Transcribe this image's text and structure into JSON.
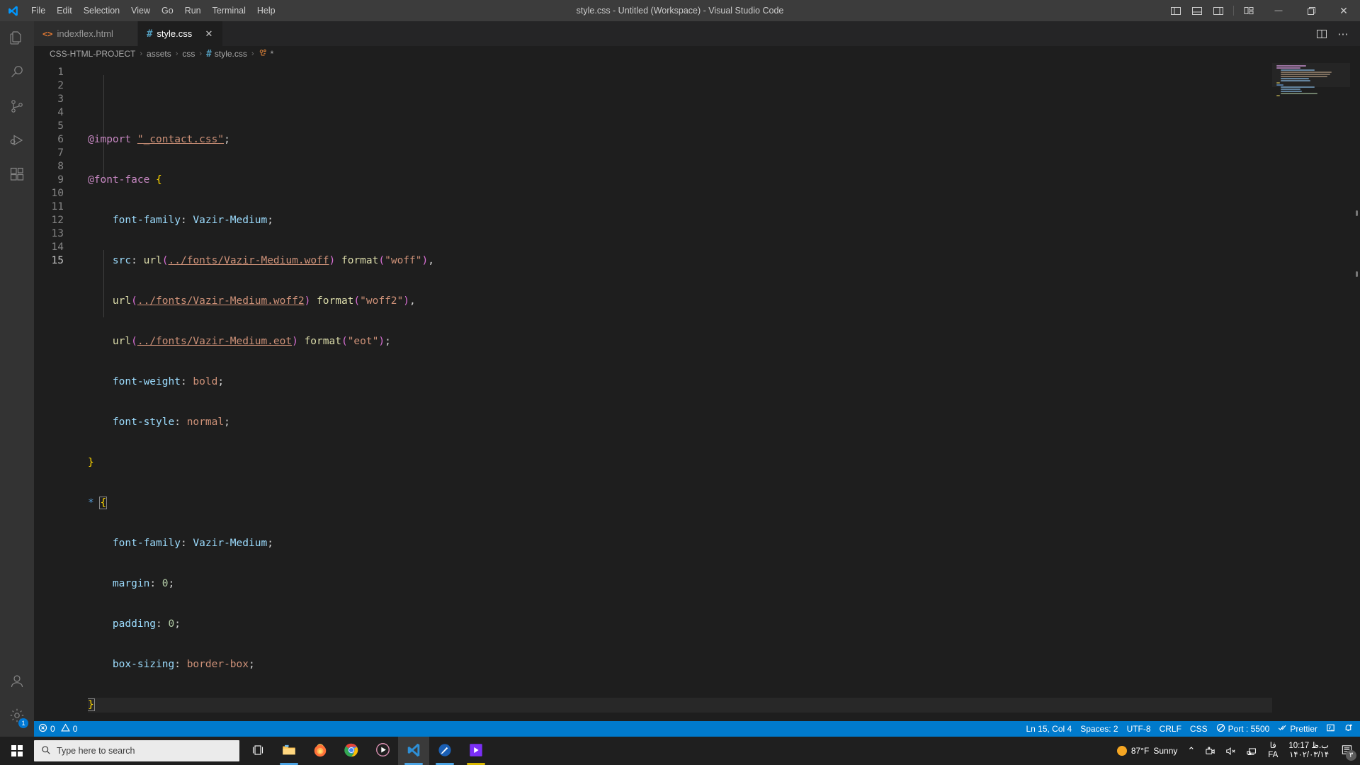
{
  "titlebar": {
    "title": "style.css - Untitled (Workspace) - Visual Studio Code",
    "menu": [
      "File",
      "Edit",
      "Selection",
      "View",
      "Go",
      "Run",
      "Terminal",
      "Help"
    ],
    "layout_icons": [
      "toggle-primary-sidebar-icon",
      "toggle-panel-icon",
      "toggle-secondary-sidebar-icon",
      "customize-layout-icon"
    ],
    "window_controls": {
      "minimize": "—",
      "maximize": "❐",
      "close": "✕"
    }
  },
  "activitybar": {
    "items": [
      {
        "name": "explorer",
        "icon": "files-icon"
      },
      {
        "name": "search",
        "icon": "search-icon"
      },
      {
        "name": "source-control",
        "icon": "source-control-icon"
      },
      {
        "name": "run-and-debug",
        "icon": "run-debug-icon"
      },
      {
        "name": "extensions",
        "icon": "extensions-icon"
      }
    ],
    "bottom": [
      {
        "name": "accounts",
        "icon": "account-icon",
        "badge": null
      },
      {
        "name": "manage",
        "icon": "gear-icon",
        "badge": "1"
      }
    ]
  },
  "tabs": [
    {
      "label": "indexflex.html",
      "icon": "html-icon",
      "icon_glyph": "<>",
      "active": false,
      "dirty": false
    },
    {
      "label": "style.css",
      "icon": "css-icon",
      "icon_glyph": "#",
      "active": true,
      "dirty": false,
      "close_glyph": "✕"
    }
  ],
  "tab_actions": [
    {
      "name": "split-editor-right",
      "icon": "split-editor-icon"
    },
    {
      "name": "more-actions",
      "icon": "ellipsis-icon",
      "glyph": "⋯"
    }
  ],
  "breadcrumb": {
    "segments": [
      "CSS-HTML-PROJECT",
      "assets",
      "css",
      "style.css",
      "*"
    ],
    "file_icon_glyph": "#",
    "symbol_icon": "css-selector-icon",
    "separator": "›"
  },
  "editor": {
    "language": "css",
    "lines": [
      {
        "n": 1,
        "fold": "",
        "text": "@import \"_contact.css\";"
      },
      {
        "n": 2,
        "fold": "",
        "text": "@font-face {"
      },
      {
        "n": 3,
        "fold": "",
        "text": "    font-family: Vazir-Medium;"
      },
      {
        "n": 4,
        "fold": "",
        "text": "    src: url(../fonts/Vazir-Medium.woff) format(\"woff\"),"
      },
      {
        "n": 5,
        "fold": "",
        "text": "    url(../fonts/Vazir-Medium.woff2) format(\"woff2\"),"
      },
      {
        "n": 6,
        "fold": "",
        "text": "    url(../fonts/Vazir-Medium.eot) format(\"eot\");"
      },
      {
        "n": 7,
        "fold": "",
        "text": "    font-weight: bold;"
      },
      {
        "n": 8,
        "fold": "",
        "text": "    font-style: normal;"
      },
      {
        "n": 9,
        "fold": "",
        "text": "}"
      },
      {
        "n": 10,
        "fold": "",
        "text": "* {"
      },
      {
        "n": 11,
        "fold": "",
        "text": "    font-family: Vazir-Medium;"
      },
      {
        "n": 12,
        "fold": "",
        "text": "    margin: 0;"
      },
      {
        "n": 13,
        "fold": "",
        "text": "    padding: 0;"
      },
      {
        "n": 14,
        "fold": "",
        "text": "    box-sizing: border-box;"
      },
      {
        "n": 15,
        "fold": "",
        "text": "}"
      }
    ],
    "cursor_line": 15,
    "total_lines": 15
  },
  "statusbar": {
    "left": [
      {
        "name": "problems",
        "icon": "error-icon",
        "text": "0",
        "icon2": "warning-icon",
        "text2": "0"
      }
    ],
    "right": [
      {
        "name": "editor-position",
        "text": "Ln 15, Col 4"
      },
      {
        "name": "indentation",
        "text": "Spaces: 2"
      },
      {
        "name": "encoding",
        "text": "UTF-8"
      },
      {
        "name": "eol",
        "text": "CRLF"
      },
      {
        "name": "language-mode",
        "text": "CSS"
      },
      {
        "name": "live-server-port",
        "text": "Port : 5500",
        "icon": "broadcast-icon"
      },
      {
        "name": "prettier",
        "text": "Prettier",
        "icon": "check-all-icon"
      },
      {
        "name": "remote-tunnel",
        "text": "",
        "icon": "remote-icon"
      },
      {
        "name": "notifications",
        "text": "",
        "icon": "bell-dot-icon"
      }
    ],
    "accent_color": "#007acc"
  },
  "taskbar": {
    "search_placeholder": "Type here to search",
    "pinned": [
      {
        "name": "task-view",
        "icon": "task-view-icon"
      },
      {
        "name": "file-explorer",
        "icon": "folder-icon",
        "running": true
      },
      {
        "name": "firefox",
        "icon": "firefox-icon",
        "running": false
      },
      {
        "name": "google-chrome",
        "icon": "chrome-icon",
        "running": false
      },
      {
        "name": "media-player",
        "icon": "media-player-icon",
        "running": false
      },
      {
        "name": "visual-studio-code",
        "icon": "vscode-icon",
        "running": true,
        "active": true
      },
      {
        "name": "sketch-app",
        "icon": "sketch-icon",
        "running": true
      },
      {
        "name": "video-editor",
        "icon": "video-editor-icon",
        "running": true
      }
    ],
    "tray": {
      "weather_temp": "87°F",
      "weather_desc": "Sunny",
      "weather_icon": "sun-icon",
      "chevron": "⌃",
      "icons": [
        "camera-icon",
        "volume-muted-icon",
        "network-icon"
      ],
      "language_top": "فا",
      "language_bottom": "FA",
      "time": "10:17 ب.ظ",
      "date": "۱۴۰۲/۰۳/۱۴",
      "notification_icon": "action-center-icon",
      "notification_badge": "۳"
    }
  }
}
